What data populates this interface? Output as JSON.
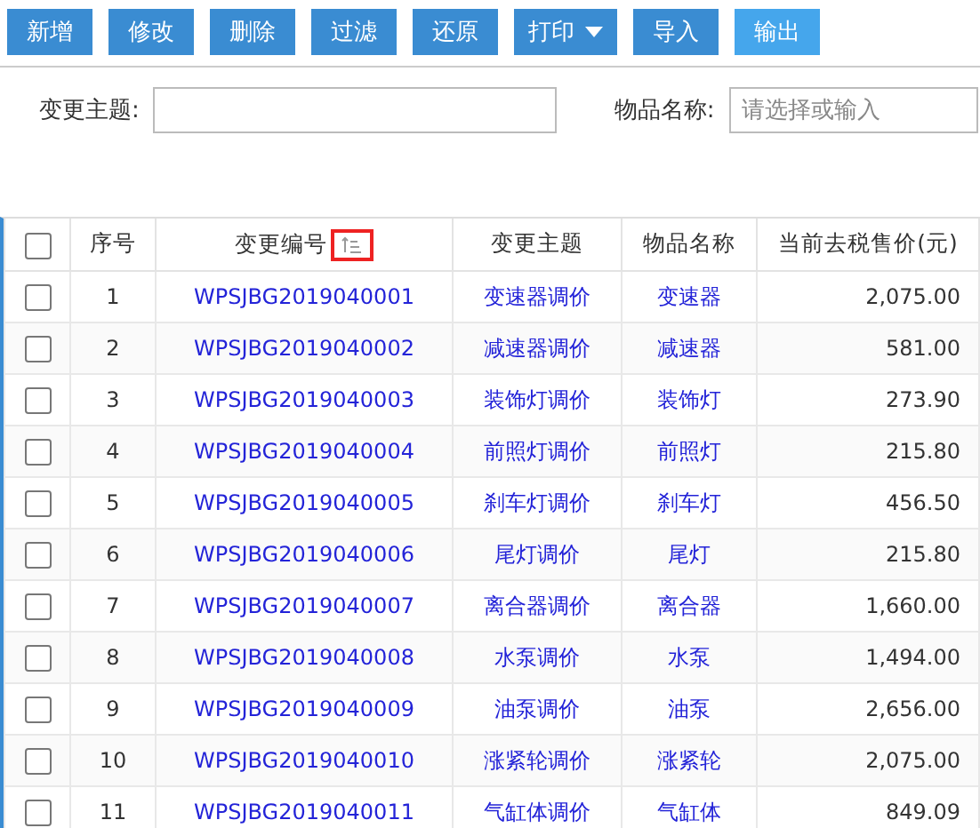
{
  "toolbar": [
    {
      "label": "新增",
      "dropdown": false,
      "highlighted": false
    },
    {
      "label": "修改",
      "dropdown": false,
      "highlighted": false
    },
    {
      "label": "删除",
      "dropdown": false,
      "highlighted": false
    },
    {
      "label": "过滤",
      "dropdown": false,
      "highlighted": false
    },
    {
      "label": "还原",
      "dropdown": false,
      "highlighted": false
    },
    {
      "label": "打印",
      "dropdown": true,
      "highlighted": false
    },
    {
      "label": "导入",
      "dropdown": false,
      "highlighted": false
    },
    {
      "label": "输出",
      "dropdown": false,
      "highlighted": true
    }
  ],
  "filters": [
    {
      "label": "变更主题:"
    },
    {
      "label": "物品名称:",
      "placeholder": "请选择或输入"
    }
  ],
  "table": {
    "all_checked": false,
    "columns": [
      {
        "label": "序号",
        "sortable": false
      },
      {
        "label": "变更编号",
        "sortable": true
      },
      {
        "label": "变更主题",
        "sortable": false
      },
      {
        "label": "物品名称",
        "sortable": false
      },
      {
        "label": "当前去税售价(元)",
        "sortable": false
      }
    ],
    "rows": [
      {
        "checked": false,
        "cells": [
          "1",
          "WPSJBG2019040001",
          "变速器调价",
          "变速器",
          "2,075.00"
        ]
      },
      {
        "checked": false,
        "cells": [
          "2",
          "WPSJBG2019040002",
          "减速器调价",
          "减速器",
          "581.00"
        ]
      },
      {
        "checked": false,
        "cells": [
          "3",
          "WPSJBG2019040003",
          "装饰灯调价",
          "装饰灯",
          "273.90"
        ]
      },
      {
        "checked": false,
        "cells": [
          "4",
          "WPSJBG2019040004",
          "前照灯调价",
          "前照灯",
          "215.80"
        ]
      },
      {
        "checked": false,
        "cells": [
          "5",
          "WPSJBG2019040005",
          "刹车灯调价",
          "刹车灯",
          "456.50"
        ]
      },
      {
        "checked": false,
        "cells": [
          "6",
          "WPSJBG2019040006",
          "尾灯调价",
          "尾灯",
          "215.80"
        ]
      },
      {
        "checked": false,
        "cells": [
          "7",
          "WPSJBG2019040007",
          "离合器调价",
          "离合器",
          "1,660.00"
        ]
      },
      {
        "checked": false,
        "cells": [
          "8",
          "WPSJBG2019040008",
          "水泵调价",
          "水泵",
          "1,494.00"
        ]
      },
      {
        "checked": false,
        "cells": [
          "9",
          "WPSJBG2019040009",
          "油泵调价",
          "油泵",
          "2,656.00"
        ]
      },
      {
        "checked": false,
        "cells": [
          "10",
          "WPSJBG2019040010",
          "涨紧轮调价",
          "涨紧轮",
          "2,075.00"
        ]
      },
      {
        "checked": false,
        "cells": [
          "11",
          "WPSJBG2019040011",
          "气缸体调价",
          "气缸体",
          "849.09"
        ]
      }
    ]
  }
}
